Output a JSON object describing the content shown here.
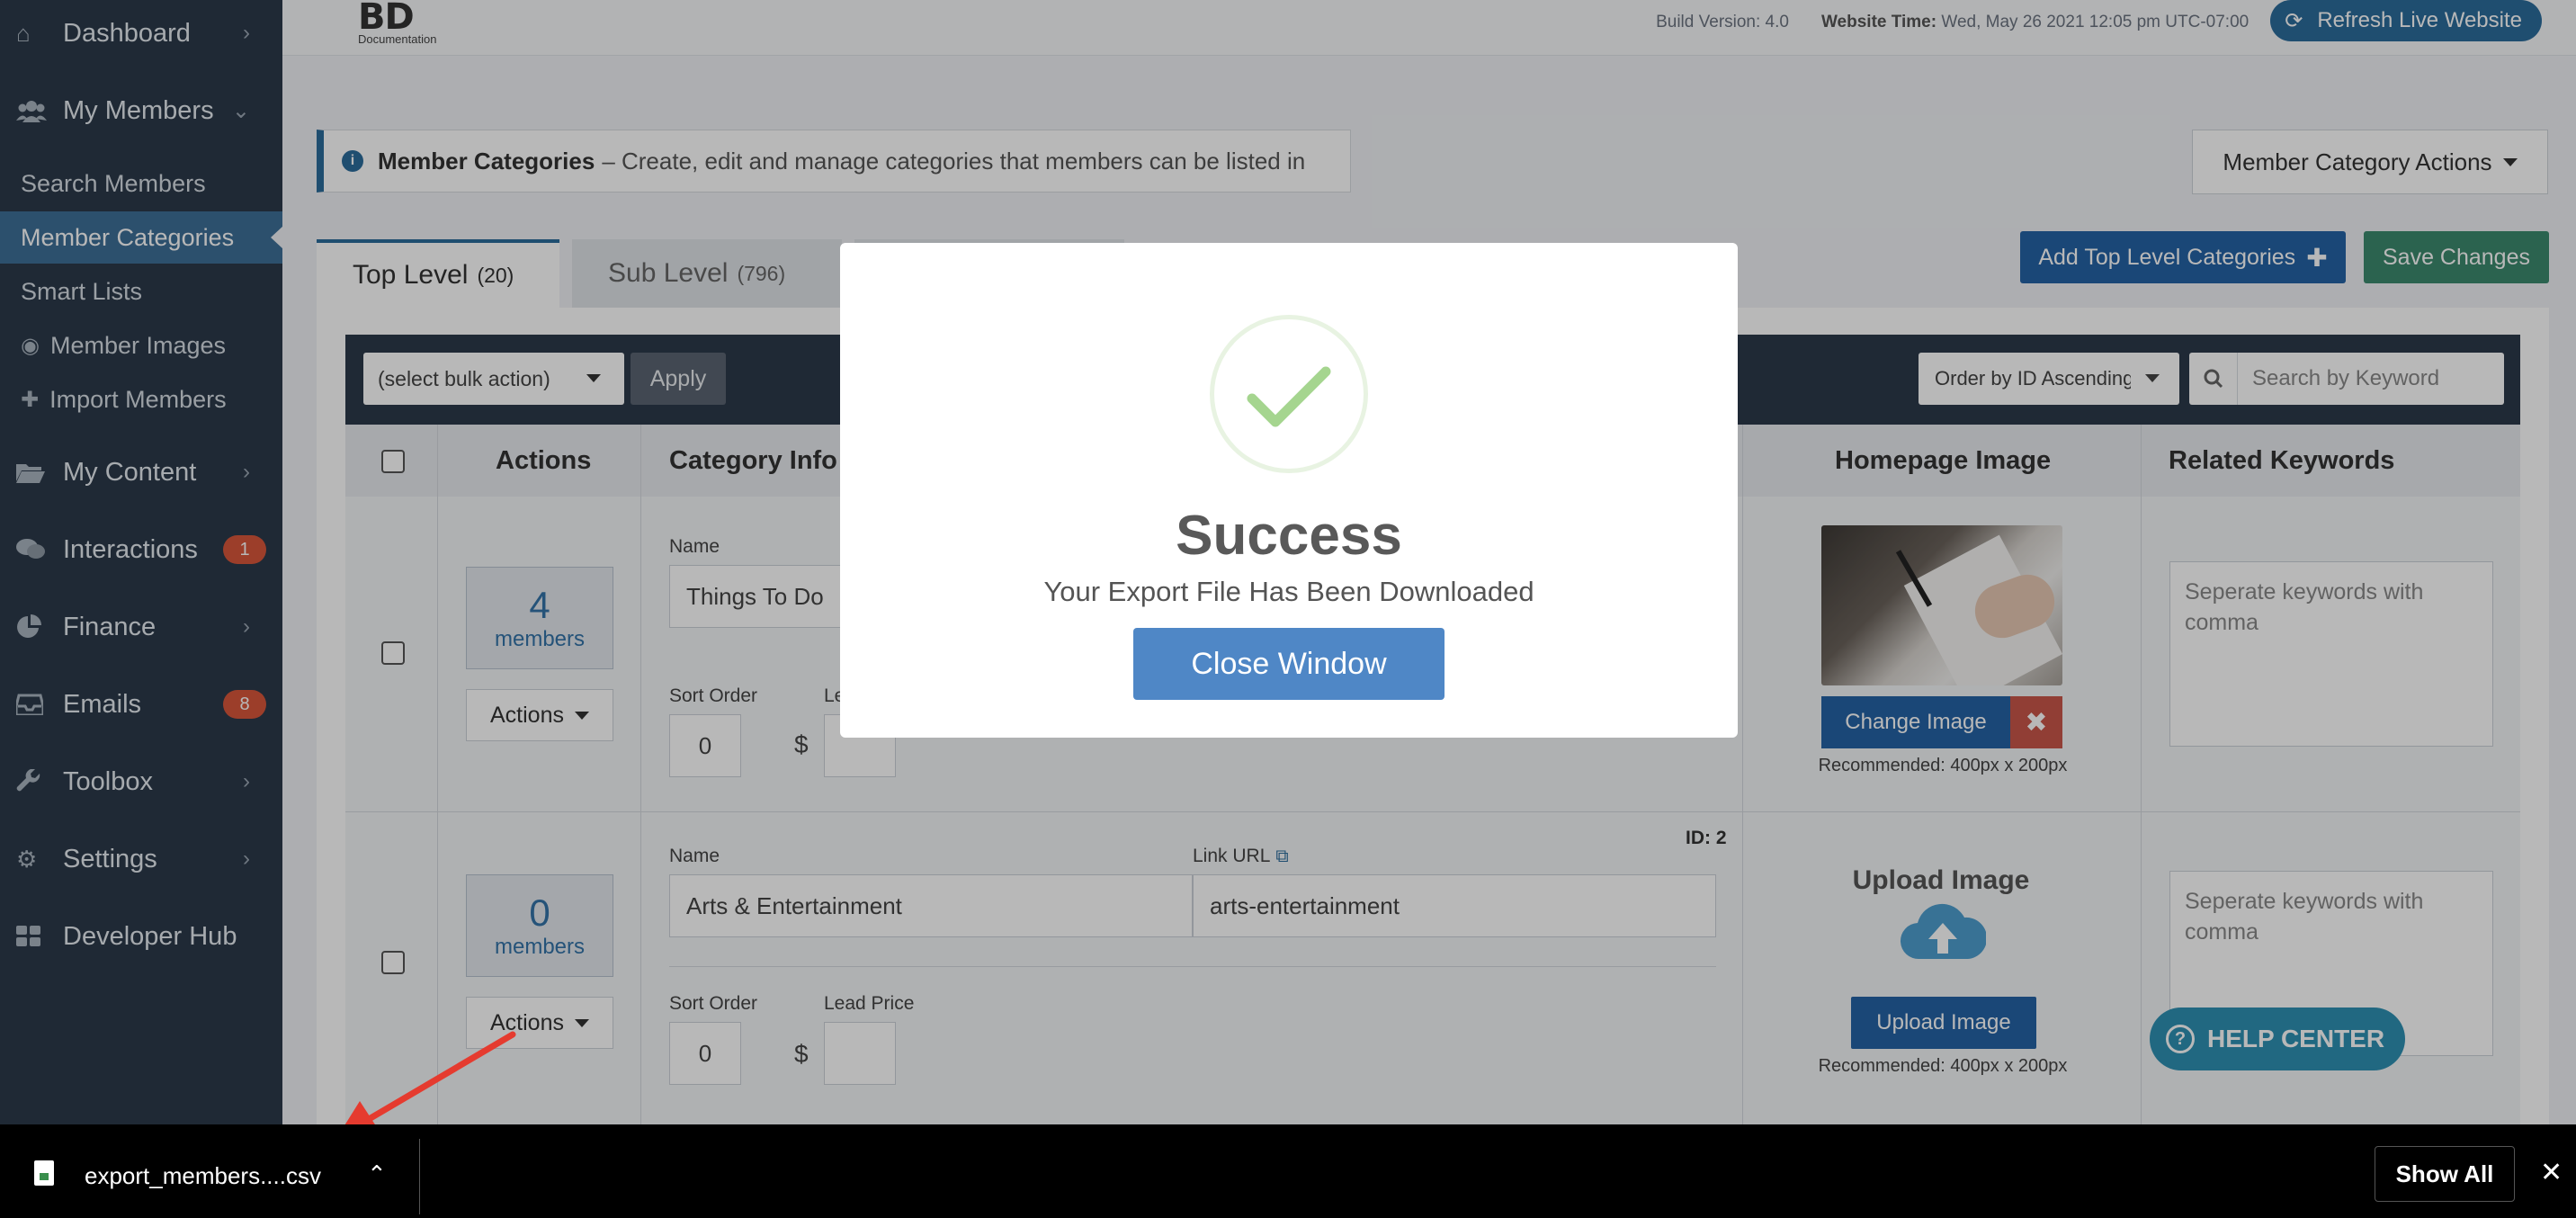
{
  "sidebar": {
    "items": [
      {
        "label": "Dashboard",
        "icon": "home-icon"
      },
      {
        "label": "My Members",
        "icon": "users-icon"
      },
      {
        "label": "My Content",
        "icon": "folder-icon"
      },
      {
        "label": "Interactions",
        "icon": "comments-icon",
        "badge": "1"
      },
      {
        "label": "Finance",
        "icon": "pie-chart-icon"
      },
      {
        "label": "Emails",
        "icon": "inbox-icon",
        "badge": "8"
      },
      {
        "label": "Toolbox",
        "icon": "wrench-icon"
      },
      {
        "label": "Settings",
        "icon": "gear-icon"
      },
      {
        "label": "Developer Hub",
        "icon": "grid-icon"
      }
    ],
    "subitems": [
      {
        "label": "Search Members"
      },
      {
        "label": "Member Categories",
        "active": true
      },
      {
        "label": "Smart Lists"
      },
      {
        "label": "Member Images",
        "icon": "user-circle-icon"
      },
      {
        "label": "Import Members",
        "icon": "plus-icon"
      }
    ]
  },
  "topbar": {
    "logo_main": "BD",
    "logo_sub": "Documentation",
    "build_version": "Build Version: 4.0",
    "website_time_label": "Website Time:",
    "website_time_value": "Wed, May 26 2021 12:05 pm UTC-07:00",
    "refresh_label": "Refresh Live Website"
  },
  "page": {
    "info_title": "Member Categories",
    "info_text": "– Create, edit and manage categories that members can be listed in",
    "category_actions_label": "Member Category Actions",
    "tabs": [
      {
        "label": "Top Level",
        "count": "(20)"
      },
      {
        "label": "Sub Level",
        "count": "(796)"
      }
    ],
    "add_button": "Add Top Level Categories",
    "save_button": "Save Changes"
  },
  "filters": {
    "bulk_action": "(select bulk action)",
    "apply": "Apply",
    "order_by": "Order by ID Ascending",
    "search_placeholder": "Search by Keyword"
  },
  "table": {
    "headers": {
      "actions": "Actions",
      "category_info": "Category Info",
      "homepage_image": "Homepage Image",
      "related_keywords": "Related Keywords"
    },
    "rows": [
      {
        "members_count": "4",
        "members_label": "members",
        "actions_label": "Actions",
        "name_label": "Name",
        "name_value": "Things To Do",
        "sort_label": "Sort Order",
        "sort_value": "0",
        "lead_label": "Le",
        "currency": "$",
        "change_image": "Change Image",
        "recommended": "Recommended: 400px x 200px",
        "keywords_placeholder": "Seperate keywords with comma"
      },
      {
        "id_label": "ID: 2",
        "members_count": "0",
        "members_label": "members",
        "actions_label": "Actions",
        "name_label": "Name",
        "name_value": "Arts & Entertainment",
        "link_label": "Link URL",
        "link_value": "arts-entertainment",
        "sort_label": "Sort Order",
        "sort_value": "0",
        "lead_label": "Lead Price",
        "currency": "$",
        "upload_title": "Upload Image",
        "upload_button": "Upload Image",
        "recommended": "Recommended: 400px x 200px",
        "keywords_placeholder": "Seperate keywords with comma"
      }
    ]
  },
  "help_center": "HELP CENTER",
  "modal": {
    "title": "Success",
    "message": "Your Export File Has Been Downloaded",
    "close_button": "Close Window"
  },
  "download_bar": {
    "filename": "export_members....csv",
    "show_all": "Show All"
  },
  "colors": {
    "sidebar_bg": "#2c3a4a",
    "accent": "#2c6c9c",
    "primary_button": "#2563a5",
    "save_button": "#3c8a6e",
    "success_check": "#a5d58f",
    "badge": "#d9573b"
  }
}
